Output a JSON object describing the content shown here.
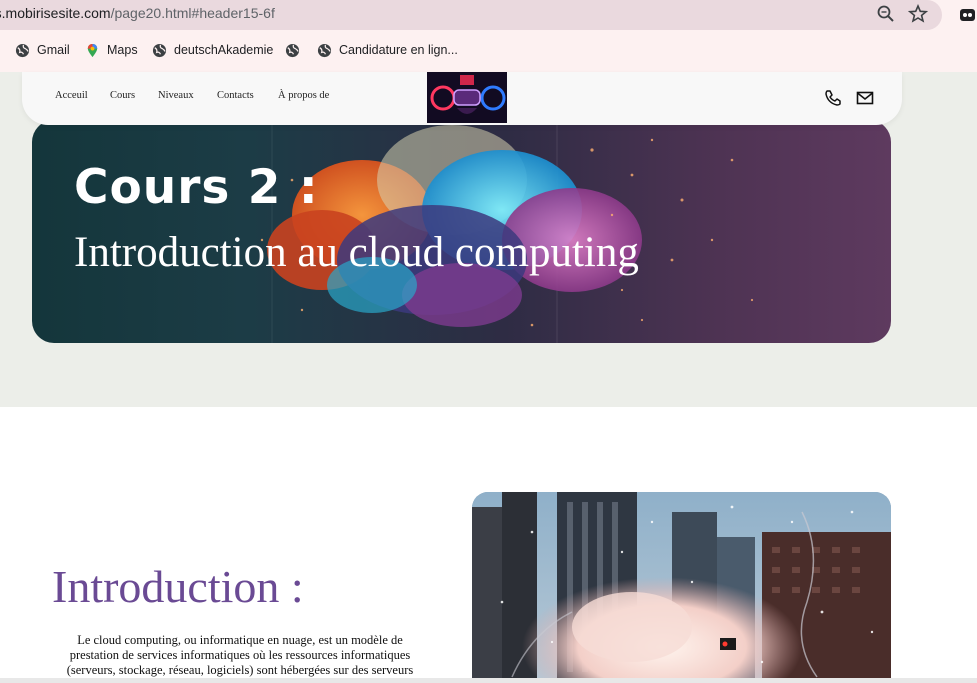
{
  "browser": {
    "url_host": "rs.mobirisesite.com",
    "url_path": "/page20.html#header15-6f",
    "bookmarks": [
      {
        "label": "Gmail",
        "icon": "globe-icon"
      },
      {
        "label": "Maps",
        "icon": "maps-pin-icon"
      },
      {
        "label": "deutschAkademie",
        "icon": "globe-icon"
      },
      {
        "label": "",
        "icon": "globe-icon"
      },
      {
        "label": "Candidature en lign...",
        "icon": "globe-icon"
      }
    ]
  },
  "nav": {
    "links": [
      "Acceuil",
      "Cours",
      "Niveaux",
      "Contacts",
      "À propos de"
    ]
  },
  "hero": {
    "title": "Cours 2 :",
    "subtitle": "Introduction au cloud computing"
  },
  "intro": {
    "title": "Introduction :",
    "text": "Le cloud computing, ou informatique en nuage, est un modèle de prestation de services informatiques où les ressources informatiques (serveurs, stockage, réseau, logiciels) sont hébergées sur des serveurs"
  },
  "colors": {
    "accent_purple": "#6a4a94",
    "hero_bg": "#2e2c44"
  }
}
